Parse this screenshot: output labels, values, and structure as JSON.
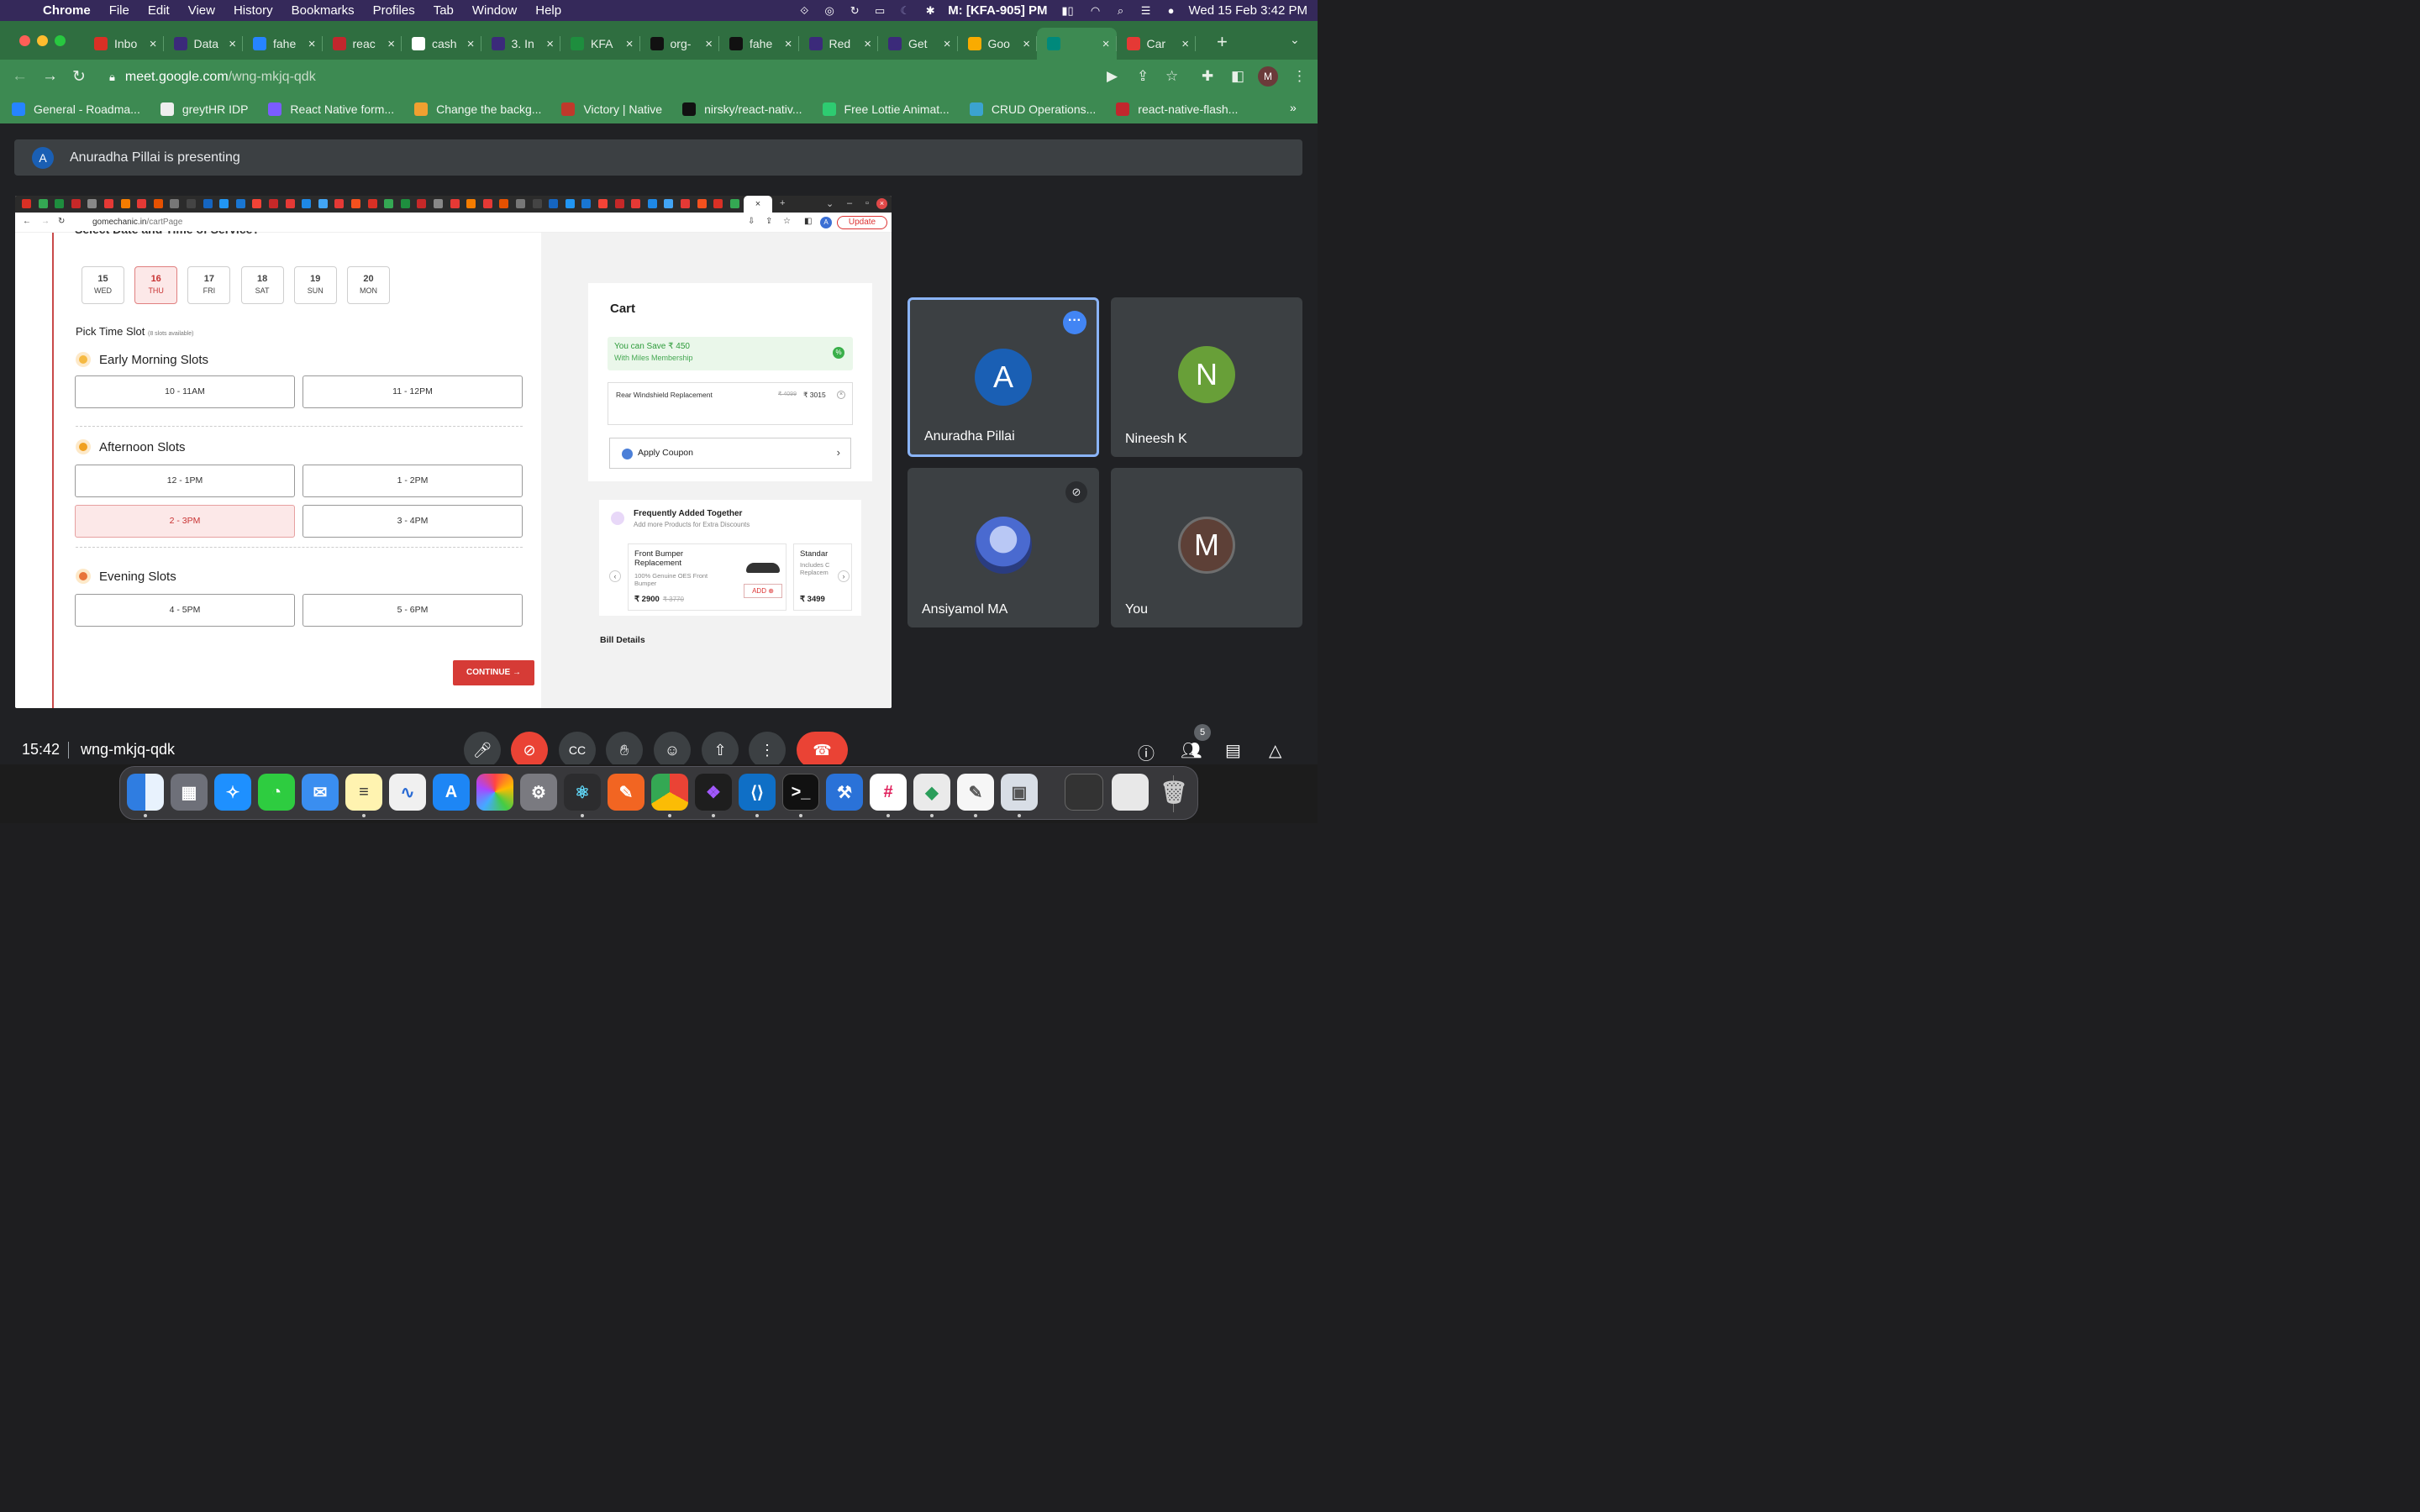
{
  "menubar": {
    "app_name": "Chrome",
    "menus": [
      "File",
      "Edit",
      "View",
      "History",
      "Bookmarks",
      "Profiles",
      "Tab",
      "Window",
      "Help"
    ],
    "status_text": "M: [KFA-905] PM",
    "datetime": "Wed 15 Feb  3:42 PM"
  },
  "browser": {
    "tabs": [
      {
        "label": "Inbo",
        "icon": "gmail-icon",
        "color": "#d93025"
      },
      {
        "label": "Data",
        "icon": "figma-icon",
        "color": "#3b2a7a"
      },
      {
        "label": "fahe",
        "icon": "bitbucket-icon",
        "color": "#2684ff"
      },
      {
        "label": "reac",
        "icon": "brand-icon",
        "color": "#c1272d"
      },
      {
        "label": "cash",
        "icon": "google-icon",
        "color": "#ffffff"
      },
      {
        "label": "3. In",
        "icon": "figma-icon",
        "color": "#3b2a7a"
      },
      {
        "label": "KFA",
        "icon": "sheets-icon",
        "color": "#1e8e3e"
      },
      {
        "label": "org-",
        "icon": "github-icon",
        "color": "#111111"
      },
      {
        "label": "fahe",
        "icon": "github-icon",
        "color": "#111111"
      },
      {
        "label": "Red",
        "icon": "figma-icon",
        "color": "#3b2a7a"
      },
      {
        "label": "Get",
        "icon": "figma-icon",
        "color": "#3b2a7a"
      },
      {
        "label": "Goo",
        "icon": "meet-icon",
        "color": "#f9ab00"
      },
      {
        "label": "",
        "icon": "meet-icon",
        "color": "#00897b"
      },
      {
        "label": "Car",
        "icon": "gomechanic-icon",
        "color": "#e53935"
      }
    ],
    "active_tab_index": 12,
    "url_host": "meet.google.com",
    "url_path": "/wng-mkjq-qdk",
    "profile_initial": "M",
    "bookmarks": [
      {
        "label": "General - Roadma...",
        "color": "#2684ff"
      },
      {
        "label": "greytHR IDP",
        "color": "#eeeeee"
      },
      {
        "label": "React Native form...",
        "color": "#7b5cff"
      },
      {
        "label": "Change the backg...",
        "color": "#f0a030"
      },
      {
        "label": "Victory | Native",
        "color": "#c0392b"
      },
      {
        "label": "nirsky/react-nativ...",
        "color": "#111111"
      },
      {
        "label": "Free Lottie Animat...",
        "color": "#2ecc71"
      },
      {
        "label": "CRUD Operations...",
        "color": "#3ba3d0"
      },
      {
        "label": "react-native-flash...",
        "color": "#c1272d"
      }
    ],
    "bookmarks_more": "»"
  },
  "meet": {
    "presenting_initial": "A",
    "presenting_text": "Anuradha Pillai is presenting",
    "time": "15:42",
    "meeting_code": "wng-mkjq-qdk",
    "participant_count": "5",
    "participants": [
      {
        "name": "Anuradha Pillai",
        "initial": "A",
        "color": "#1a5fb4"
      },
      {
        "name": "Nineesh K",
        "initial": "N",
        "color": "#689f38"
      },
      {
        "name": "Ansiyamol MA",
        "initial": "",
        "color": "#5a7ad8"
      },
      {
        "name": "You",
        "initial": "M",
        "color": "#5d4037"
      }
    ]
  },
  "shared": {
    "url_host": "gomechanic.in",
    "url_path": "/cartPage",
    "update_label": "Update",
    "avatar_initial": "A",
    "section_title": "Select Date and Time of Service?",
    "dates": [
      {
        "day": "15",
        "weekday": "WED"
      },
      {
        "day": "16",
        "weekday": "THU"
      },
      {
        "day": "17",
        "weekday": "FRI"
      },
      {
        "day": "18",
        "weekday": "SAT"
      },
      {
        "day": "19",
        "weekday": "SUN"
      },
      {
        "day": "20",
        "weekday": "MON"
      }
    ],
    "selected_date_index": 1,
    "pick_label": "Pick Time Slot",
    "pick_sub": "(8 slots available)",
    "early_title": "Early Morning Slots",
    "early_slots": [
      "10 - 11AM",
      "11 - 12PM"
    ],
    "afternoon_title": "Afternoon Slots",
    "afternoon_slots": [
      "12 - 1PM",
      "1 - 2PM",
      "2 - 3PM",
      "3 - 4PM"
    ],
    "selected_slot": "2 - 3PM",
    "evening_title": "Evening Slots",
    "evening_slots": [
      "4 - 5PM",
      "5 - 6PM"
    ],
    "continue_label": "CONTINUE →",
    "cart": {
      "title": "Cart",
      "save_line1": "You can Save ₹ 450",
      "save_line2": "With Miles Membership",
      "item_name": "Rear Windshield Replacement",
      "item_old_price": "₹ 4099",
      "item_price": "₹ 3015",
      "coupon_label": "Apply Coupon"
    },
    "fat": {
      "title": "Frequently Added Together",
      "subtitle": "Add more Products for Extra Discounts",
      "card1_name": "Front Bumper Replacement",
      "card1_desc": "100% Genuine OES Front Bumper",
      "card1_price": "₹ 2900",
      "card1_old": "₹ 3770",
      "card1_add": "ADD ⊕",
      "card2_name": "Standar",
      "card2_desc": "Includes C Replacem",
      "card2_price": "₹ 3499"
    },
    "bill_label": "Bill Details"
  }
}
